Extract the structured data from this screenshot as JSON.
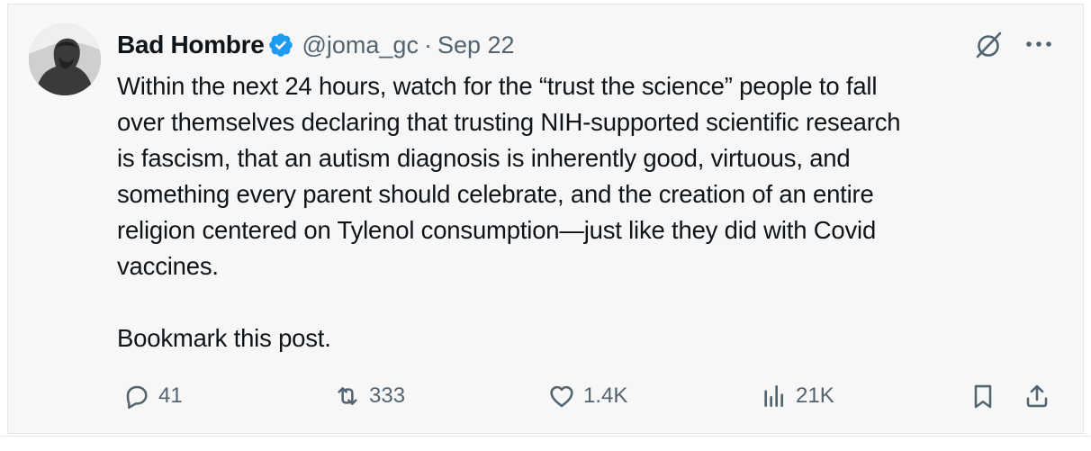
{
  "tweet": {
    "display_name": "Bad Hombre",
    "handle": "@joma_gc",
    "separator": "·",
    "date": "Sep 22",
    "text": "Within the next 24 hours, watch for the “trust the science” people to fall\nover themselves declaring that trusting NIH-supported scientific research\nis fascism, that an autism diagnosis is inherently good, virtuous, and\nsomething every parent should celebrate, and the creation of an entire\nreligion centered on Tylenol consumption—just like they did with Covid\nvaccines.\n\nBookmark this post."
  },
  "actions": {
    "replies": "41",
    "reposts": "333",
    "likes": "1.4K",
    "views": "21K"
  },
  "icons": {
    "avatar": "user-avatar",
    "verified": "verified-badge-icon",
    "grok": "grok-icon",
    "more": "more-icon",
    "reply": "reply-icon",
    "repost": "repost-icon",
    "like": "heart-icon",
    "views": "views-icon",
    "bookmark": "bookmark-icon",
    "share": "share-icon"
  },
  "colors": {
    "text": "#0f1419",
    "secondary": "#536471",
    "verified": "#1d9bf0",
    "card_background": "#f7f7f7"
  }
}
